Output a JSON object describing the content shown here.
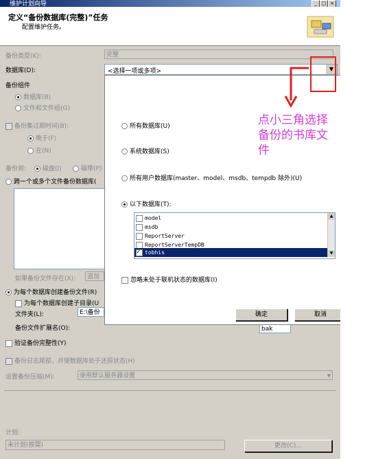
{
  "window": {
    "title": "维护计划向导"
  },
  "header": {
    "title": "定义“备份数据库(完整)”任务",
    "subtitle": "配置维护任务。"
  },
  "form": {
    "backup_type_label": "备份类型(K):",
    "backup_type_value": "完整",
    "database_label": "数据库(D):",
    "database_placeholder": "<选择一项或多项>",
    "backup_component_label": "备份组件",
    "radio_database": "数据库(B)",
    "radio_files": "文件和文件组(G)",
    "expire_label": "备份集过期时间(B):",
    "radio_after": "晚于(F)",
    "radio_on": "在(N)",
    "backup_to_label": "备份到:",
    "radio_disk": "磁盘(I)",
    "radio_tape": "磁带(P)",
    "span_files_label": "跨一个或多个文件备份数据库(",
    "if_exists_label": "如果备份文件存在(X):",
    "if_exists_value": "追加",
    "per_db_file_label": "为每个数据库创建备份文件(R)",
    "per_db_subdir_label": "为每个数据库创建子目录(U",
    "folder_label": "文件夹(L):",
    "folder_value": "E:\\备份",
    "ext_label": "备份文件扩展名(O):",
    "ext_value": "bak",
    "verify_label": "验证备份完整性(Y)",
    "tail_log_label": "备份日志尾部，并使数据库处于还原状态(H)",
    "compression_label": "设置备份压缩(M):",
    "compression_value": "使用默认服务器设置",
    "schedule_label": "计划:",
    "schedule_value": "未计划(按需)",
    "change_button": "更改(C)..."
  },
  "popup": {
    "all_db": "所有数据库(U)",
    "system_db": "系统数据库(S)",
    "user_db": "所有用户数据库(master、model、msdb、tempdb 除外)(U)",
    "these_db": "以下数据库(T):",
    "databases": [
      {
        "name": "model",
        "checked": false,
        "selected": false
      },
      {
        "name": "msdb",
        "checked": false,
        "selected": false
      },
      {
        "name": "ReportServer",
        "checked": false,
        "selected": false
      },
      {
        "name": "ReportServerTempDB",
        "checked": false,
        "selected": false
      },
      {
        "name": "tobhis",
        "checked": true,
        "selected": true
      }
    ],
    "ignore_offline": "忽略未处于联机状态的数据库(I)",
    "ok_button": "确定",
    "cancel_button": "取消"
  },
  "annotation": {
    "text": "点小三角选择备份的书库文件",
    "color": "#d43ad8",
    "box_color": "#e02020"
  }
}
